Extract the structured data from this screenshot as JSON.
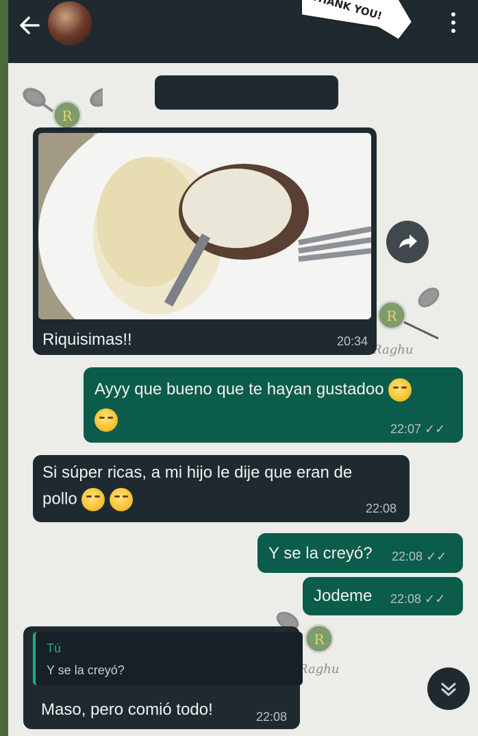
{
  "header": {
    "back_icon": "arrow-left-icon",
    "sticker_text": "THANK YOU!",
    "menu_icon": "more-vert-icon"
  },
  "watermark": {
    "brand_text": "Raghu",
    "logo_letter": "R"
  },
  "messages": [
    {
      "id": "m1",
      "direction": "incoming",
      "type": "image",
      "caption": "Riquisimas!!",
      "time": "20:34"
    },
    {
      "id": "m2",
      "direction": "outgoing",
      "text_line1": "Ayyy que bueno que te hayan gustadoo",
      "time": "22:07"
    },
    {
      "id": "m3",
      "direction": "incoming",
      "text_line1": "Si súper ricas, a mi hijo le dije que eran de",
      "text_line2": "pollo",
      "time": "22:08"
    },
    {
      "id": "m4",
      "direction": "outgoing",
      "text": "Y se la creyó?",
      "time": "22:08"
    },
    {
      "id": "m5",
      "direction": "outgoing",
      "text": "Jodeme",
      "time": "22:08"
    },
    {
      "id": "m6",
      "direction": "incoming",
      "quote_author": "Tú",
      "quote_text": "Y se la creyó?",
      "text": "Maso, pero comió todo!",
      "time": "22:08"
    }
  ],
  "icons": {
    "forward": "forward-icon",
    "scroll_down": "double-chevron-down-icon",
    "read_receipt": "double-check-icon"
  },
  "colors": {
    "incoming_bubble": "#1f2a30",
    "outgoing_bubble": "#0b5c4a",
    "quote_accent": "#1fae80"
  }
}
